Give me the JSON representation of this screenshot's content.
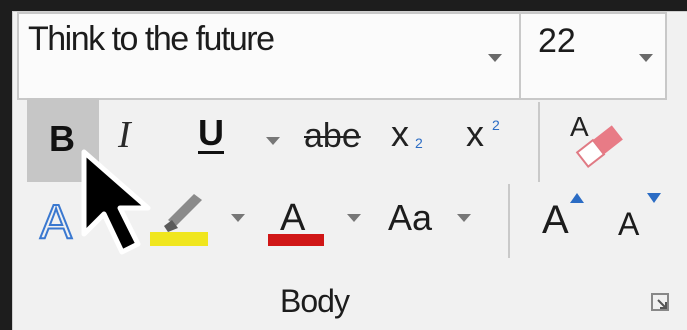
{
  "font": {
    "name": "Think to the future",
    "size": "22"
  },
  "buttons": {
    "bold": "B",
    "italic": "I",
    "underline": "U",
    "strikethrough": "abe",
    "subscript_base": "x",
    "subscript_mark": "2",
    "superscript_base": "x",
    "superscript_mark": "2",
    "text_effects": "A",
    "font_color": "A",
    "change_case": "Aa",
    "grow_font": "A",
    "shrink_font": "A"
  },
  "colors": {
    "highlight": "#f0e61e",
    "font_color": "#d01616",
    "accent": "#2b6cc4"
  },
  "group_label": "Body",
  "icons": [
    "chevron-down-icon",
    "eraser-icon",
    "text-effects-icon",
    "highlighter-icon",
    "cursor-arrow-icon",
    "dialog-launcher-icon"
  ]
}
